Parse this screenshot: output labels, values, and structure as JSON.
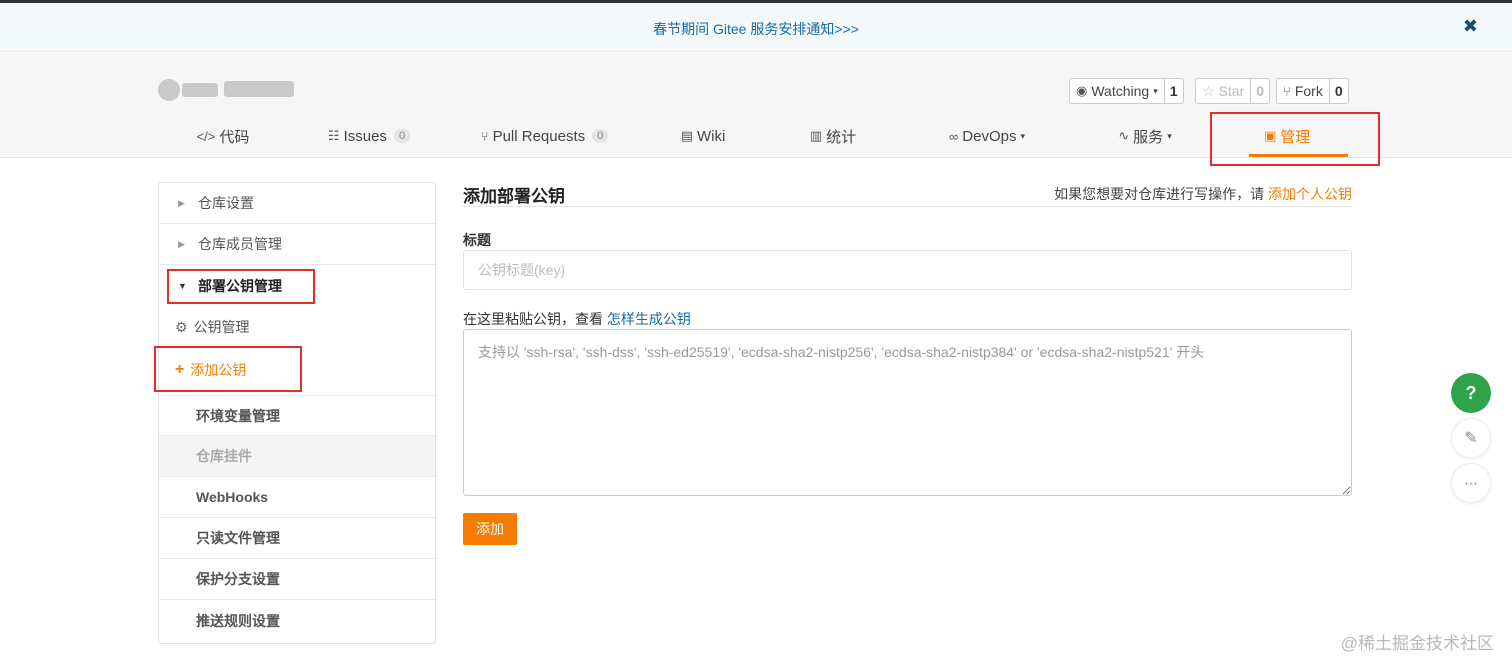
{
  "notice": {
    "text": "春节期间 Gitee 服务安排通知>>>",
    "close": "✖"
  },
  "repo_actions": {
    "watching": {
      "label": "Watching",
      "count": "1"
    },
    "star": {
      "label": "Star",
      "count": "0"
    },
    "fork": {
      "label": "Fork",
      "count": "0"
    }
  },
  "tabs": [
    {
      "icon": "</>",
      "label": "代码"
    },
    {
      "icon": "☷",
      "label": "Issues",
      "badge": "0"
    },
    {
      "icon": "⑂",
      "label": "Pull Requests",
      "badge": "0"
    },
    {
      "icon": "▤",
      "label": "Wiki"
    },
    {
      "icon": "▥",
      "label": "统计"
    },
    {
      "icon": "∞",
      "label": "DevOps",
      "caret": "▾"
    },
    {
      "icon": "∿",
      "label": "服务",
      "caret": "▾"
    },
    {
      "icon": "▣",
      "label": "管理"
    }
  ],
  "sidebar": {
    "items": [
      {
        "label": "仓库设置"
      },
      {
        "label": "仓库成员管理"
      },
      {
        "label": "部署公钥管理"
      },
      {
        "label": "公钥管理"
      },
      {
        "label": "添加公钥"
      },
      {
        "label": "环境变量管理"
      },
      {
        "label": "仓库挂件"
      },
      {
        "label": "WebHooks"
      },
      {
        "label": "只读文件管理"
      },
      {
        "label": "保护分支设置"
      },
      {
        "label": "推送规则设置"
      }
    ]
  },
  "form": {
    "title": "添加部署公钥",
    "hint_prefix": "如果您想要对仓库进行写操作，请",
    "hint_link": "添加个人公钥",
    "title_label": "标题",
    "title_placeholder": "公钥标题(key)",
    "key_label_prefix": "在这里粘贴公钥，查看",
    "key_label_link": "怎样生成公钥",
    "key_placeholder": "支持以 'ssh-rsa', 'ssh-dss', 'ssh-ed25519', 'ecdsa-sha2-nistp256', 'ecdsa-sha2-nistp384' or 'ecdsa-sha2-nistp521' 开头",
    "submit": "添加"
  },
  "float": {
    "help": "?",
    "edit": "✎",
    "chat": "⋯"
  },
  "watermark": "@稀土掘金技术社区",
  "colors": {
    "accent": "#f57c00",
    "link": "#1a6aa6",
    "highlight_box": "#e0302a"
  }
}
